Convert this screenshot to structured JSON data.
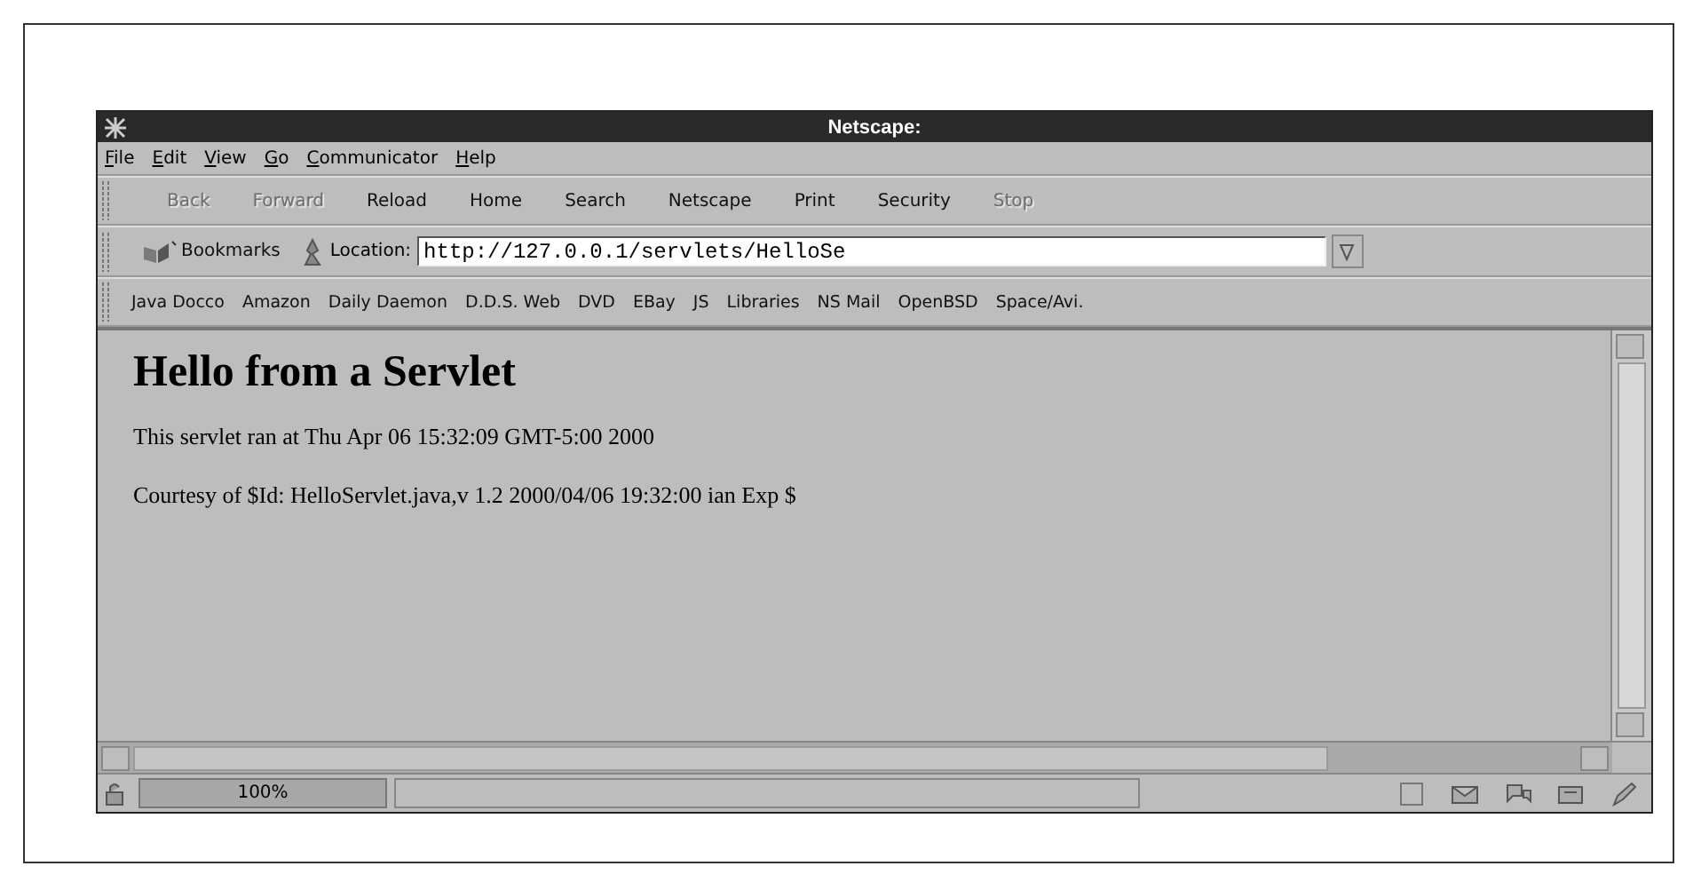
{
  "window": {
    "title": "Netscape:"
  },
  "menu": [
    {
      "label": "File"
    },
    {
      "label": "Edit"
    },
    {
      "label": "View"
    },
    {
      "label": "Go"
    },
    {
      "label": "Communicator"
    },
    {
      "label": "Help"
    }
  ],
  "toolbar": [
    {
      "label": "Back",
      "disabled": true
    },
    {
      "label": "Forward",
      "disabled": true
    },
    {
      "label": "Reload",
      "disabled": false
    },
    {
      "label": "Home",
      "disabled": false
    },
    {
      "label": "Search",
      "disabled": false
    },
    {
      "label": "Netscape",
      "disabled": false
    },
    {
      "label": "Print",
      "disabled": false
    },
    {
      "label": "Security",
      "disabled": false
    },
    {
      "label": "Stop",
      "disabled": true
    }
  ],
  "location_bar": {
    "bookmarks": "Bookmarks",
    "label": "Location:",
    "value": "http://127.0.0.1/servlets/HelloSe"
  },
  "personal_toolbar": [
    "Java Docco",
    "Amazon",
    "Daily Daemon",
    "D.D.S. Web",
    "DVD",
    "EBay",
    "JS",
    "Libraries",
    "NS Mail",
    "OpenBSD",
    "Space/Avi."
  ],
  "page": {
    "heading": "Hello from a Servlet",
    "paragraphs": [
      "This servlet ran at Thu Apr 06 15:32:09 GMT-5:00 2000",
      "Courtesy of $Id: HelloServlet.java,v 1.2 2000/04/06 19:32:00 ian Exp $"
    ]
  },
  "status_bar": {
    "zoom": "100%"
  }
}
